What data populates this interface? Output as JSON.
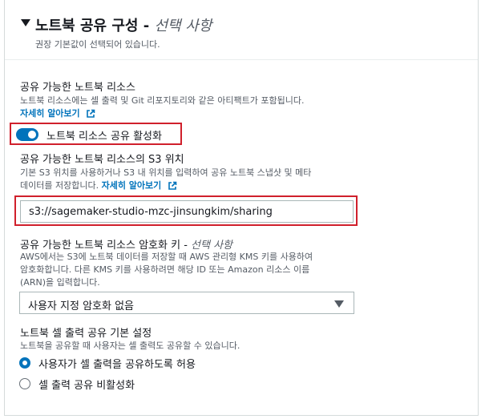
{
  "section": {
    "title": "노트북 공유 구성 - ",
    "title_optional": "선택 사항",
    "subtitle": "권장 기본값이 선택되어 있습니다."
  },
  "shareable": {
    "label": "공유 가능한 노트북 리소스",
    "description": "노트북 리소스에는 셀 출력 및 Git 리포지토리와 같은 아티팩트가 포함됩니다.",
    "learn_more": "자세히 알아보기",
    "toggle_label": "노트북 리소스 공유 활성화",
    "toggle_on": true
  },
  "s3": {
    "label": "공유 가능한 노트북 리소스의 S3 위치",
    "description_line1": "기본 S3 위치를 사용하거나 S3 내 위치를 입력하여 공유 노트북 스냅샷 및 메타",
    "description_line2": "데이터를 저장합니다.",
    "learn_more": "자세히 알아보기",
    "value": "s3://sagemaker-studio-mzc-jinsungkim/sharing"
  },
  "encryption": {
    "label": "공유 가능한 노트북 리소스 암호화 키 - ",
    "label_optional": "선택 사항",
    "description_line1": "AWS에서는 S3에 노트북 데이터를 저장할 때 AWS 관리형 KMS 키를 사용하여",
    "description_line2": "암호화합니다. 다른 KMS 키를 사용하려면 해당 ID 또는 Amazon 리소스 이름",
    "description_line3": "(ARN)을 입력합니다.",
    "selected": "사용자 지정 암호화 없음"
  },
  "cell_output": {
    "label": "노트북 셀 출력 공유 기본 설정",
    "description": "노트북을 공유할 때 사용자는 셀 출력도 공유할 수 있습니다.",
    "options": [
      {
        "label": "사용자가 셀 출력을 공유하도록 허용",
        "selected": true
      },
      {
        "label": "셀 출력 공유 비활성화",
        "selected": false
      }
    ]
  },
  "colors": {
    "accent": "#0073bb",
    "highlight": "#d0202c",
    "border": "#aab7b8"
  }
}
